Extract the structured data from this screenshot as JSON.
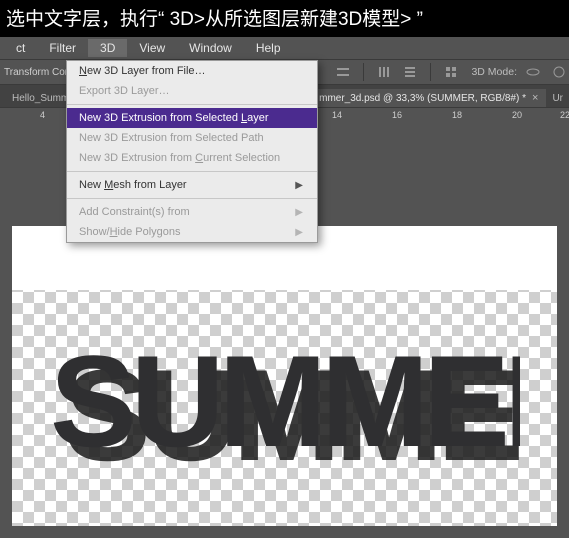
{
  "instruction": "选中文字层，执行“ 3D>从所选图层新建3D模型> ”",
  "menu": {
    "items": [
      "ct",
      "Filter",
      "3D",
      "View",
      "Window",
      "Help"
    ],
    "open_index": 2
  },
  "optionsbar": {
    "label": "Transform Con",
    "mode3d_label": "3D Mode:"
  },
  "tabs": {
    "left": "Hello_Summ",
    "active": "mmer_3d.psd @ 33,3% (SUMMER, RGB/8#) *",
    "right_stub": "Ur"
  },
  "ruler": {
    "left_num": "4",
    "right_nums": [
      "14",
      "16",
      "18",
      "20",
      "22"
    ]
  },
  "dropdown": {
    "new_layer": "New 3D Layer from File…",
    "export": "Export 3D Layer…",
    "ext_layer": "New 3D Extrusion from Selected Layer",
    "ext_path": "New 3D Extrusion from Selected Path",
    "ext_sel": "New 3D Extrusion from Current Selection",
    "mesh": "New Mesh from Layer",
    "constraints": "Add Constraint(s) from",
    "polys": "Show/Hide Polygons"
  },
  "canvas": {
    "text": "SUMMER"
  }
}
